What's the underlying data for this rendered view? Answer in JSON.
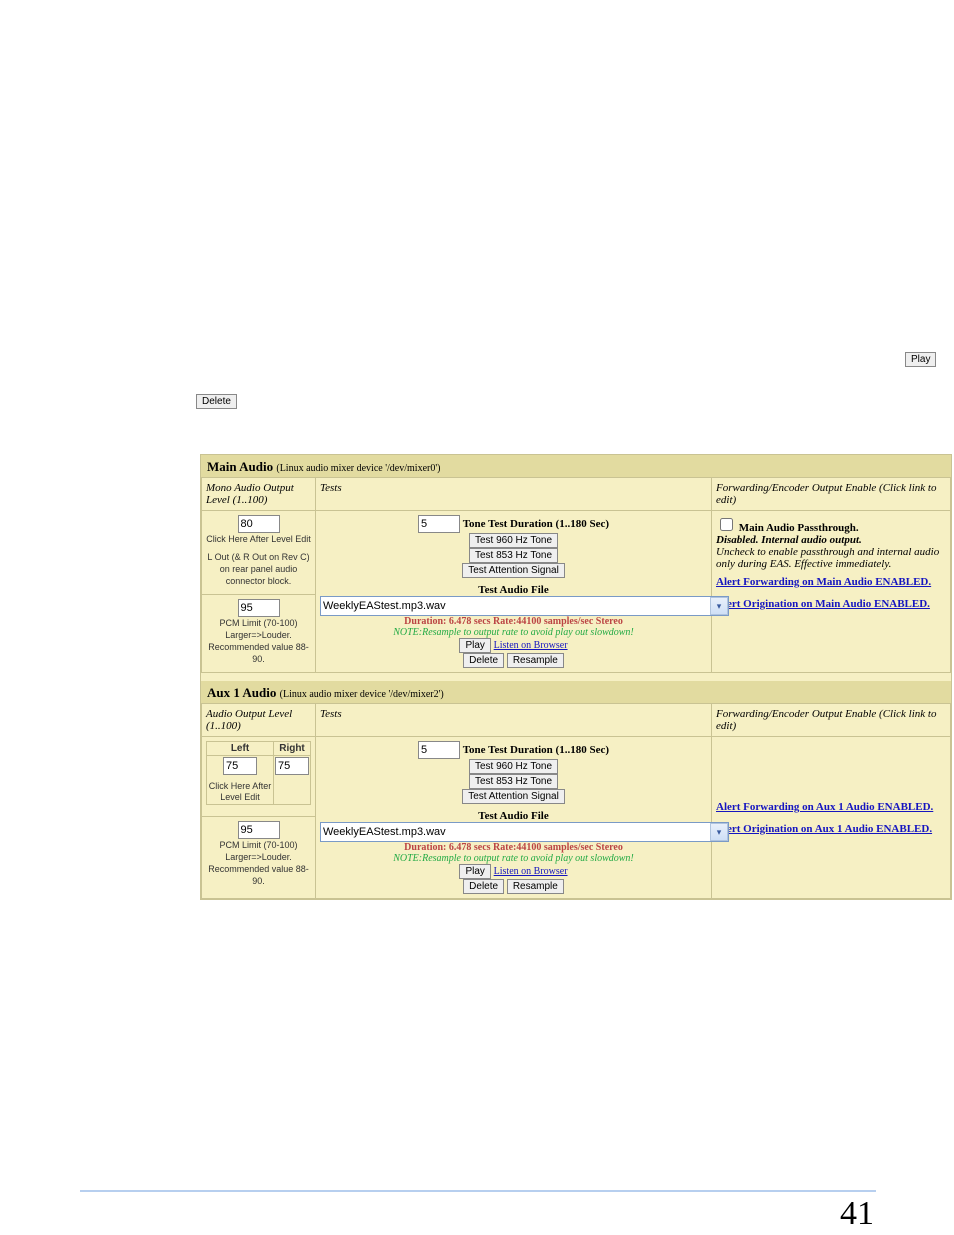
{
  "orphan": {
    "play": "Play",
    "delete": "Delete"
  },
  "page_number": "41",
  "main": {
    "title": "Main Audio",
    "subtitle": "(Linux audio mixer device '/dev/mixer0')",
    "hdr": {
      "c1": "Mono Audio Output Level (1..100)",
      "c2": "Tests",
      "c3": "Forwarding/Encoder Output Enable (Click link to edit)"
    },
    "level": {
      "value": "80",
      "click_here": "Click Here After Level Edit",
      "hint": "L Out (& R Out on Rev C) on rear panel audio connector block."
    },
    "pcm": {
      "value": "95",
      "label": "PCM Limit (70-100) Larger=>Louder. Recommended value 88-90."
    },
    "tests": {
      "dur_value": "5",
      "dur_label": "Tone Test Duration (1..180 Sec)",
      "b960": "Test 960 Hz Tone",
      "b853": "Test 853 Hz Tone",
      "battn": "Test Attention Signal",
      "file_label": "Test Audio File",
      "file_value": "WeeklyEAStest.mp3.wav",
      "dur_line": "Duration: 6.478 secs  Rate:44100 samples/sec  Stereo",
      "resample_note": "NOTE:Resample to output rate to avoid play out slowdown!",
      "play": "Play",
      "listen": "Listen on Browser",
      "delete": "Delete",
      "resample": "Resample"
    },
    "fwd": {
      "chk_label": "Main Audio Passthrough.",
      "disabled": "Disabled. Internal audio output.",
      "hint": "Uncheck to enable passthrough and internal audio only during EAS. Effective immediately.",
      "fwd_link": "Alert Forwarding on Main Audio ENABLED.",
      "orig_link": "Alert Origination on Main Audio ENABLED."
    }
  },
  "aux1": {
    "title": "Aux 1 Audio",
    "subtitle": "(Linux audio mixer device '/dev/mixer2')",
    "hdr": {
      "c1": "Audio Output Level (1..100)",
      "c2": "Tests",
      "c3": "Forwarding/Encoder Output Enable (Click link to edit)"
    },
    "level": {
      "left_label": "Left",
      "right_label": "Right",
      "left": "75",
      "right": "75",
      "click_here": "Click Here After Level Edit"
    },
    "pcm": {
      "value": "95",
      "label": "PCM Limit (70-100) Larger=>Louder. Recommended value 88-90."
    },
    "tests": {
      "dur_value": "5",
      "dur_label": "Tone Test Duration (1..180 Sec)",
      "b960": "Test 960 Hz Tone",
      "b853": "Test 853 Hz Tone",
      "battn": "Test Attention Signal",
      "file_label": "Test Audio File",
      "file_value": "WeeklyEAStest.mp3.wav",
      "dur_line": "Duration: 6.478 secs  Rate:44100 samples/sec  Stereo",
      "resample_note": "NOTE:Resample to output rate to avoid play out slowdown!",
      "play": "Play",
      "listen": "Listen on Browser",
      "delete": "Delete",
      "resample": "Resample"
    },
    "fwd": {
      "fwd_link": "Alert Forwarding on Aux 1 Audio ENABLED.",
      "orig_link": "Alert Origination on Aux 1 Audio ENABLED."
    }
  }
}
